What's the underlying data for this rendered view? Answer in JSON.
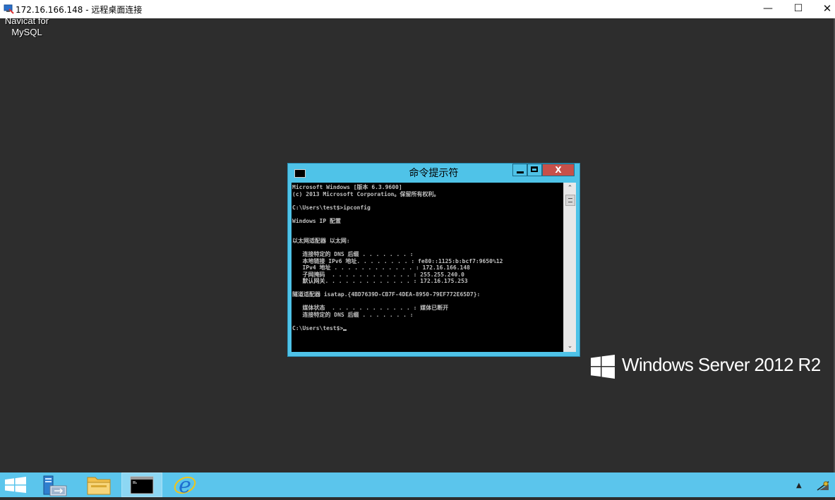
{
  "rdp": {
    "title": "172.16.166.148 - 远程桌面连接",
    "min_label": "—",
    "max_label": "☐",
    "close_label": "✕"
  },
  "desktop": {
    "icon_label_line1": "Navicat for",
    "icon_label_line2": "MySQL",
    "brand_text": "Windows Server 2012 R2"
  },
  "cmd": {
    "title": "命令提示符",
    "close_label": "X",
    "lines": [
      "Microsoft Windows [版本 6.3.9600]",
      "(c) 2013 Microsoft Corporation。保留所有权利。",
      "",
      "C:\\Users\\test$>ipconfig",
      "",
      "Windows IP 配置",
      "",
      "",
      "以太网适配器 以太网:",
      "",
      "   连接特定的 DNS 后缀 . . . . . . . :",
      "   本地链接 IPv6 地址. . . . . . . . : fe80::1125:b:bcf7:9650%12",
      "   IPv4 地址 . . . . . . . . . . . . : 172.16.166.148",
      "   子网掩码  . . . . . . . . . . . . : 255.255.240.0",
      "   默认网关. . . . . . . . . . . . . : 172.16.175.253",
      "",
      "隧道适配器 isatap.{4BD7639D-CB7F-4DEA-8950-79EF772E65D7}:",
      "",
      "   媒体状态  . . . . . . . . . . . . : 媒体已断开",
      "   连接特定的 DNS 后缀 . . . . . . . :",
      "",
      "C:\\Users\\test$>"
    ]
  },
  "taskbar": {
    "items": [
      {
        "name": "start-button",
        "icon": "windows-logo-icon"
      },
      {
        "name": "server-manager",
        "icon": "server-manager-icon"
      },
      {
        "name": "file-explorer",
        "icon": "folder-icon"
      },
      {
        "name": "command-prompt",
        "icon": "cmd-icon",
        "active": true
      },
      {
        "name": "internet-explorer",
        "icon": "ie-icon"
      }
    ],
    "tray_arrow": "▲"
  },
  "colors": {
    "desktop": "#2d2d2d",
    "taskbar": "#5bc5ec",
    "cmd_frame": "#4fc3e8",
    "close_red": "#c7504a"
  }
}
